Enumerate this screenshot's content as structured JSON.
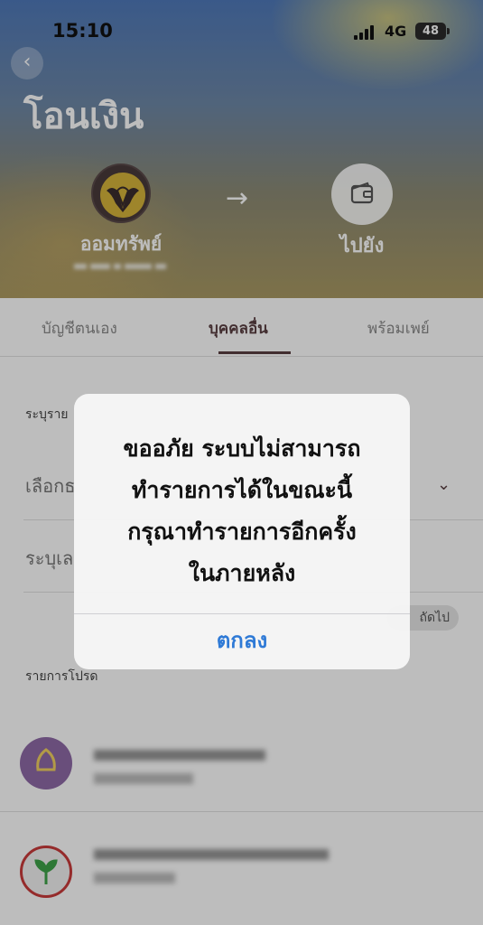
{
  "status_bar": {
    "time": "15:10",
    "network": "4G",
    "battery": "48"
  },
  "header": {
    "title": "โอนเงิน"
  },
  "transfer": {
    "from_name": "ออมทรัพย์",
    "to_label": "ไปยัง"
  },
  "tabs": [
    {
      "label": "บัญชีตนเอง"
    },
    {
      "label": "บุคคลอื่น",
      "active": true
    },
    {
      "label": "พร้อมเพย์"
    }
  ],
  "form": {
    "section_label": "ระบุราย",
    "select_text": "เลือกธ",
    "input_text": "ระบุเล",
    "next_button": "ถัดไป"
  },
  "favorites": {
    "label": "รายการโปรด"
  },
  "alert": {
    "message": "ขออภัย ระบบไม่สามารถ\nทำรายการได้ในขณะนี้\nกรุณาทำรายการอีกครั้ง\nในภายหลัง",
    "ok_button": "ตกลง"
  },
  "colors": {
    "accent": "#5a3e42",
    "alert_button": "#2f7ad6"
  },
  "icons": {
    "back": "chevron-left-icon",
    "arrow": "arrow-right-icon",
    "wallet": "wallet-icon",
    "dropdown": "chevron-down-icon"
  }
}
